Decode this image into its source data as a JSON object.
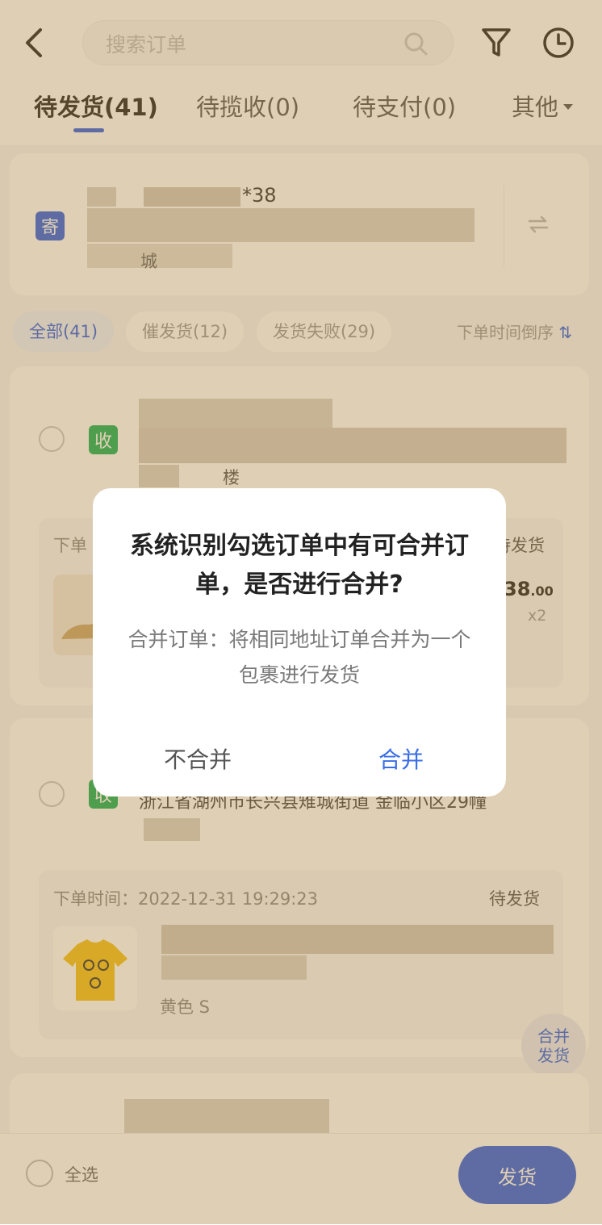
{
  "header": {
    "search_placeholder": "搜索订单"
  },
  "tabs": [
    {
      "label": "待发货(41)",
      "active": true
    },
    {
      "label": "待揽收(0)",
      "active": false
    },
    {
      "label": "待支付(0)",
      "active": false
    },
    {
      "label": "其他",
      "active": false
    }
  ],
  "sender": {
    "badge": "寄",
    "name_partial": "*38",
    "address_tail": "城"
  },
  "filters": {
    "chips": [
      "全部(41)",
      "催发货(12)",
      "发货失败(29)"
    ],
    "sort": "下单时间倒序"
  },
  "orders": [
    {
      "badge": "收",
      "address_tail": "楼",
      "time_label": "下单",
      "status": "待发货",
      "price_int": "38",
      "price_dec": ".00",
      "qty": "x2"
    },
    {
      "badge": "收",
      "address_line": "浙江省湖州市长兴县雉城街道 金临小区29幢",
      "time_label": "下单时间：",
      "time": "2022-12-31 19:29:23",
      "status": "待发货",
      "variant": "黄色 S"
    }
  ],
  "fab": {
    "line1": "合并",
    "line2": "发货"
  },
  "footer": {
    "select_all": "全选",
    "ship_button": "发货"
  },
  "dialog": {
    "title": "系统识别勾选订单中有可合并订单，是否进行合并?",
    "body": "合并订单：将相同地址订单合并为一个包裹进行发货",
    "cancel": "不合并",
    "confirm": "合并"
  },
  "colors": {
    "accent": "#2f5fe3",
    "receive_badge": "#16b05a",
    "overlay": "#aa823c"
  }
}
